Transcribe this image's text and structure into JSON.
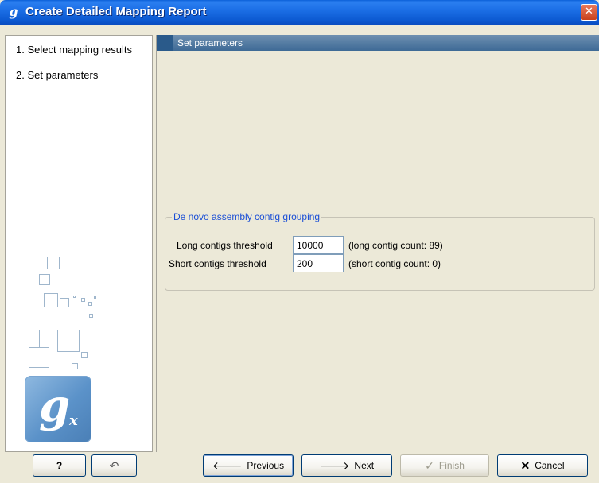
{
  "window": {
    "title": "Create Detailed Mapping Report",
    "title_icon": "g"
  },
  "steps": [
    {
      "label": "1.  Select mapping results"
    },
    {
      "label": "2.  Set parameters"
    }
  ],
  "logo": {
    "letter": "g",
    "subscript": "x"
  },
  "section": {
    "title": "Set parameters"
  },
  "group": {
    "legend": "De novo assembly contig grouping",
    "rows": [
      {
        "label": "Long contigs threshold",
        "value": "10000",
        "note": "(long contig count: 89)"
      },
      {
        "label": "Short contigs threshold",
        "value": "200",
        "note": "(short contig count: 0)"
      }
    ]
  },
  "buttons": {
    "help": "?",
    "reset_icon": "↶",
    "previous": "Previous",
    "next": "Next",
    "finish": "Finish",
    "cancel": "Cancel"
  }
}
